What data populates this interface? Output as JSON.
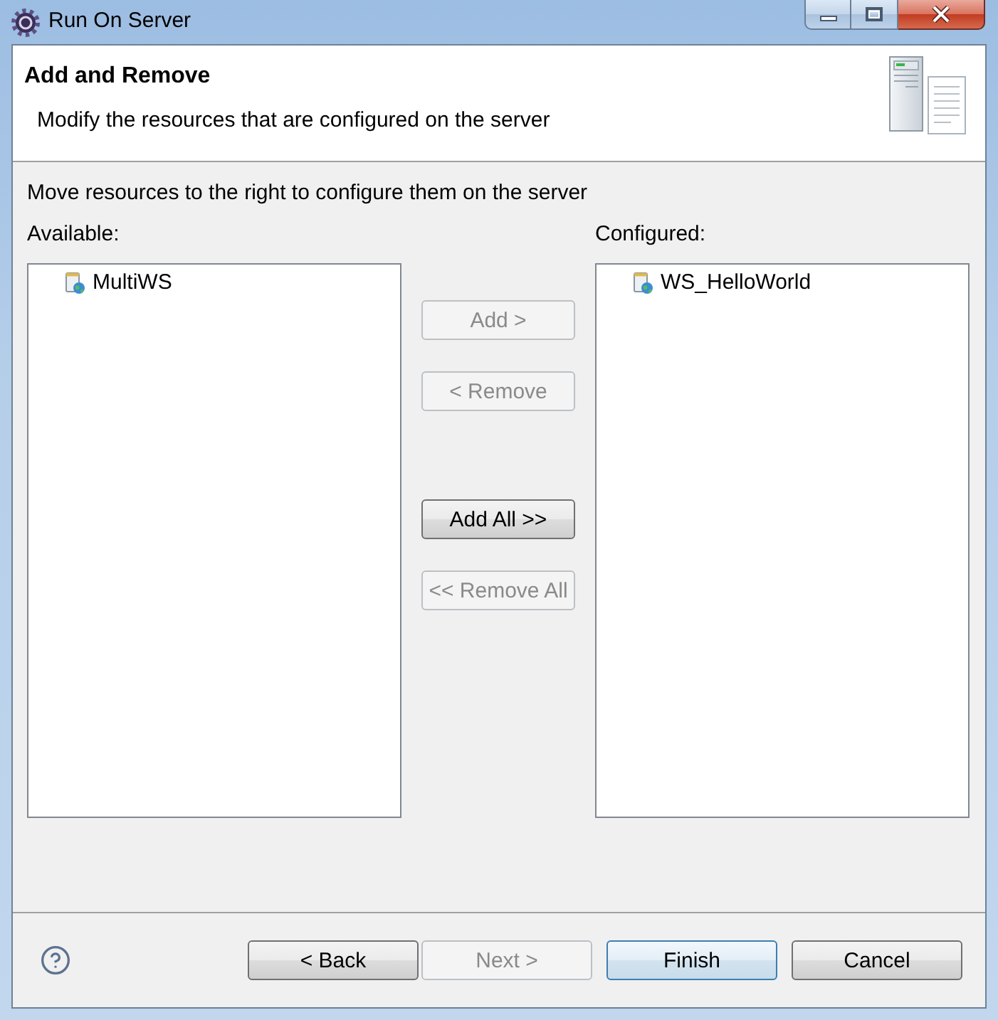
{
  "window": {
    "title": "Run On Server"
  },
  "header": {
    "title": "Add and Remove",
    "description": "Modify the resources that are configured on the server"
  },
  "instruction": "Move resources to the right to configure them on the server",
  "available": {
    "label": "Available:",
    "items": [
      {
        "name": "MultiWS",
        "selected": false
      }
    ]
  },
  "transfer_button_groups": [
    {
      "buttons": [
        {
          "label": "Add >",
          "disabled": true
        },
        {
          "label": "< Remove",
          "disabled": true
        }
      ]
    },
    {
      "buttons": [
        {
          "label": "Add All >>",
          "disabled": false
        },
        {
          "label": "<< Remove All",
          "disabled": true
        }
      ]
    }
  ],
  "configured": {
    "label": "Configured:",
    "items": [
      {
        "name": "WS_HelloWorld",
        "selected": false
      }
    ]
  },
  "navigation_buttons": [
    {
      "label": "< Back",
      "disabled": false,
      "default": false
    },
    {
      "label": "Next >",
      "disabled": true,
      "default": false
    }
  ],
  "action_buttons": [
    {
      "label": "Finish",
      "disabled": false,
      "default": true
    },
    {
      "label": "Cancel",
      "disabled": false,
      "default": false
    }
  ]
}
